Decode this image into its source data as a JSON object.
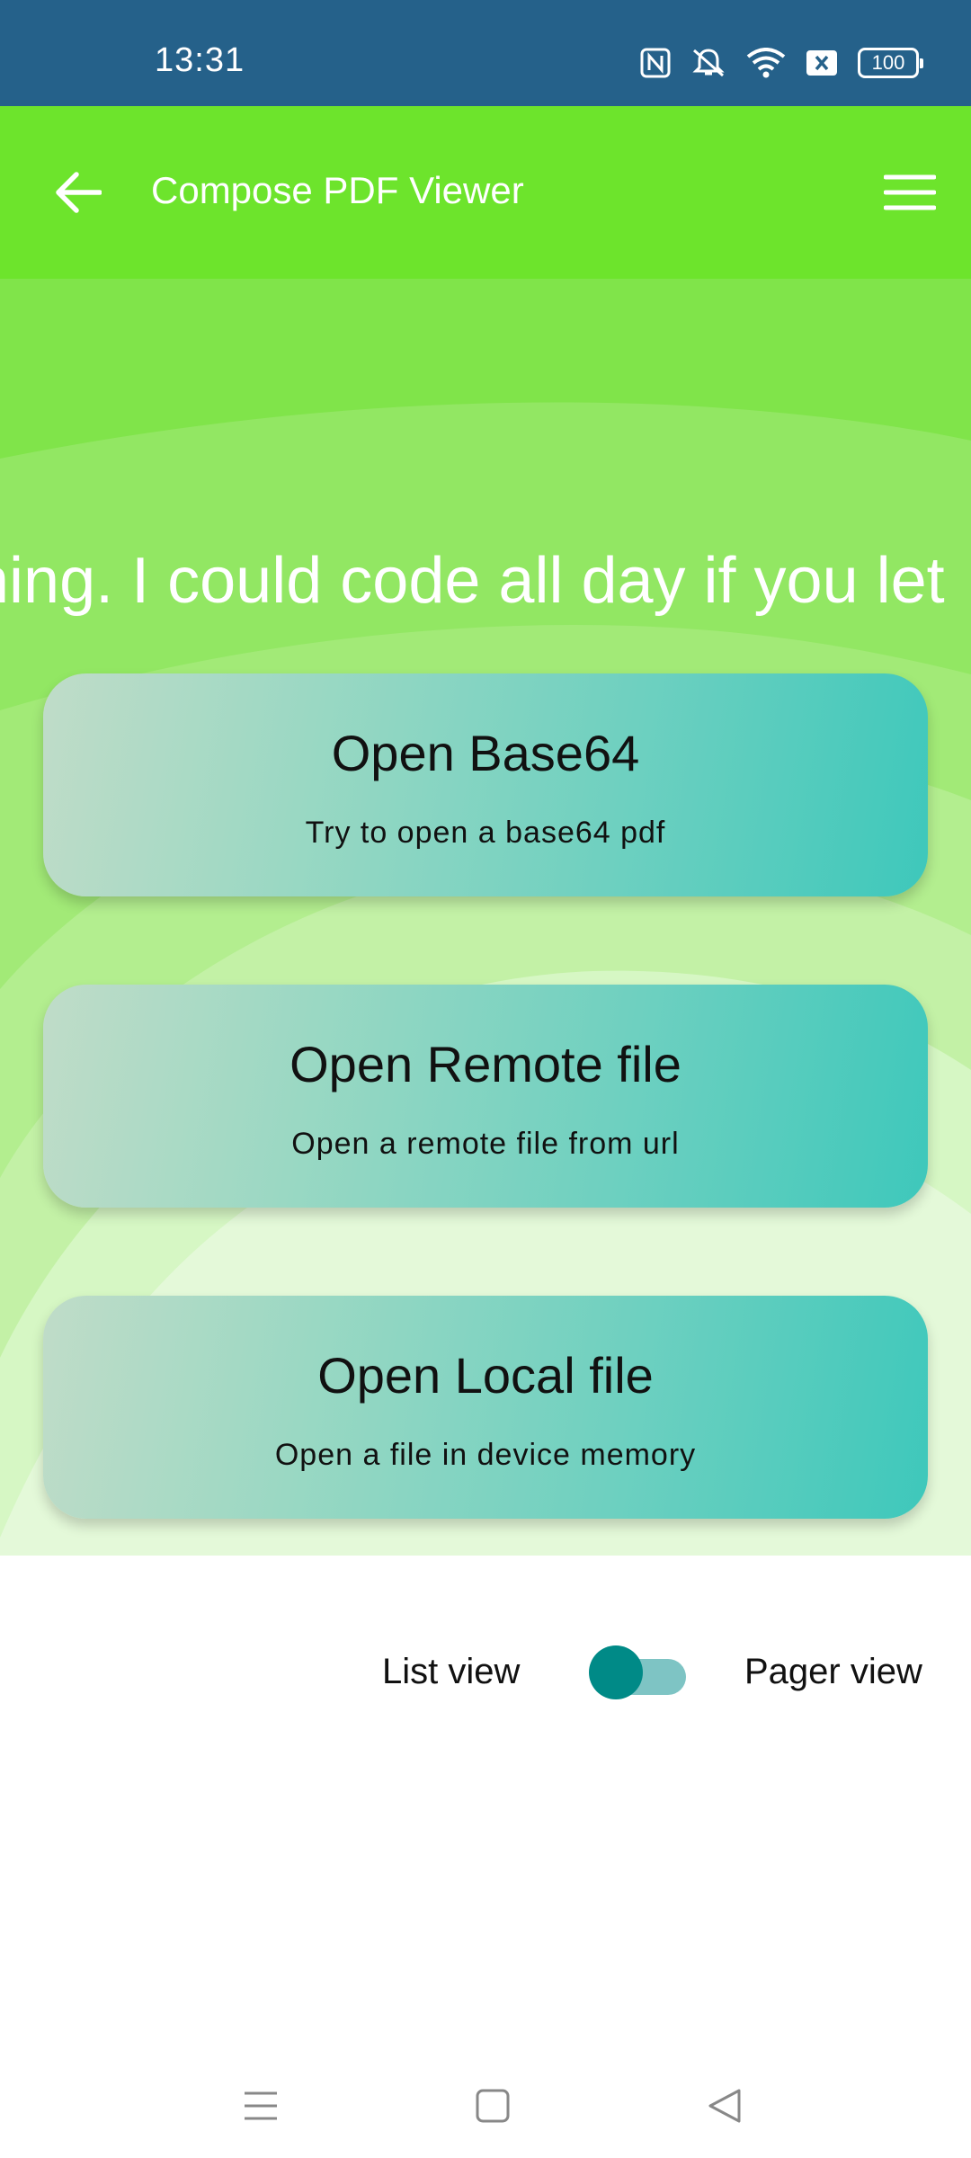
{
  "status_bar": {
    "time": "13:31",
    "battery": "100",
    "icons": [
      "nfc-icon",
      "mute-icon",
      "wifi-icon",
      "sim-off-icon",
      "battery-icon"
    ]
  },
  "app_bar": {
    "title": "Compose PDF Viewer",
    "back_icon": "arrow-back-icon",
    "menu_icon": "menu-icon",
    "color": "#6de42c"
  },
  "marquee": {
    "text": "hing. I could code all day if you let"
  },
  "cards": [
    {
      "title": "Open Base64",
      "subtitle": "Try to open a base64 pdf"
    },
    {
      "title": "Open Remote file",
      "subtitle": "Open a remote file from url"
    },
    {
      "title": "Open Local file",
      "subtitle": "Open a file in device memory"
    }
  ],
  "view_toggle": {
    "left_label": "List view",
    "right_label": "Pager view",
    "checked": false,
    "thumb_color": "#008a87",
    "track_color": "#7ec4c4"
  },
  "nav_bar": {
    "icons": [
      "recents-icon",
      "home-icon",
      "back-triangle-icon"
    ]
  }
}
